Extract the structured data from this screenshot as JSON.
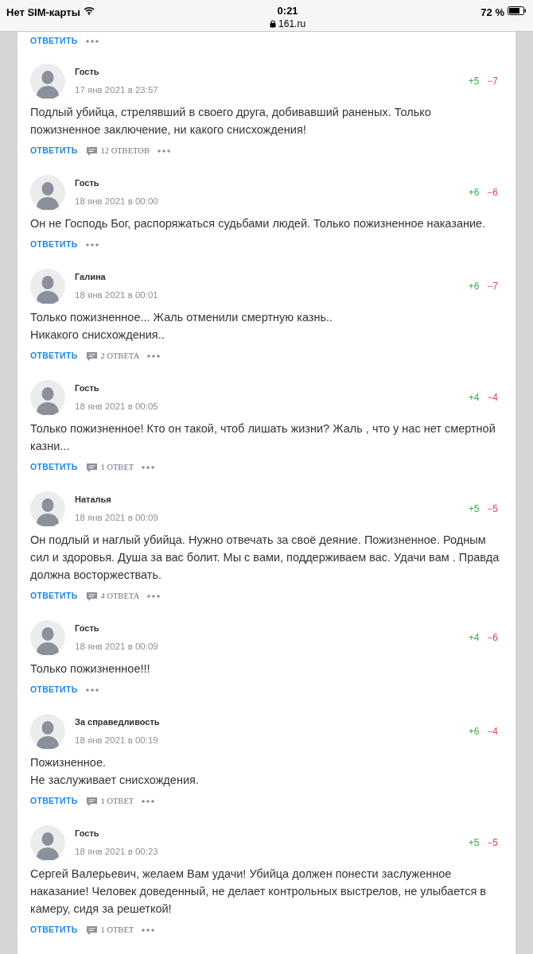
{
  "status_bar": {
    "carrier": "Нет SIM-карты",
    "time": "0:21",
    "url": "161.ru",
    "battery": "72 %"
  },
  "top_actions": {
    "reply": "ОТВЕТИТЬ"
  },
  "comments": [
    {
      "author": "Гость",
      "date": "17 янв 2021 в 23:57",
      "plus": "+5",
      "minus": "−7",
      "text": "Подлый убийца, стрелявший в своего друга, добивавший раненых. Только пожизненное заключение, ни какого снисхождения!",
      "reply": "ОТВЕТИТЬ",
      "replies": "12 ОТВЕТОВ"
    },
    {
      "author": "Гость",
      "date": "18 янв 2021 в 00:00",
      "plus": "+6",
      "minus": "−6",
      "text": "Он не Господь Бог, распоряжаться судьбами людей. Только пожизненное наказание.",
      "reply": "ОТВЕТИТЬ"
    },
    {
      "author": "Галина",
      "date": "18 янв 2021 в 00:01",
      "plus": "+6",
      "minus": "−7",
      "text": "Только пожизненное... Жаль отменили смертную казнь..\nНикакого снисхождения..",
      "reply": "ОТВЕТИТЬ",
      "replies": "2 ОТВЕТА"
    },
    {
      "author": "Гость",
      "date": "18 янв 2021 в 00:05",
      "plus": "+4",
      "minus": "−4",
      "text": "Только пожизненное! Кто он такой, чтоб лишать жизни? Жаль , что у нас нет смертной казни...",
      "reply": "ОТВЕТИТЬ",
      "replies": "1 ОТВЕТ"
    },
    {
      "author": "Наталья",
      "date": "18 янв 2021 в 00:09",
      "plus": "+5",
      "minus": "−5",
      "text": "Он подлый и наглый убийца. Нужно отвечать за своё деяние. Пожизненное. Родным сил и здоровья. Душа за вас болит. Мы с вами, поддерживаем вас. Удачи вам . Правда должна восторжествать.",
      "reply": "ОТВЕТИТЬ",
      "replies": "4 ОТВЕТА"
    },
    {
      "author": "Гость",
      "date": "18 янв 2021 в 00:09",
      "plus": "+4",
      "minus": "−6",
      "text": "Только пожизненное!!!",
      "reply": "ОТВЕТИТЬ"
    },
    {
      "author": "За справедливость",
      "date": "18 янв 2021 в 00:19",
      "plus": "+6",
      "minus": "−4",
      "text": "Пожизненное.\nНе заслуживает снисхождения.",
      "reply": "ОТВЕТИТЬ",
      "replies": "1 ОТВЕТ"
    },
    {
      "author": "Гость",
      "date": "18 янв 2021 в 00:23",
      "plus": "+5",
      "minus": "−5",
      "text": "Сергей Валерьевич, желаем Вам удачи! Убийца должен понести заслуженное наказание! Человек доведенный, не делает контрольных выстрелов, не улыбается в камеру, сидя за решеткой!",
      "reply": "ОТВЕТИТЬ",
      "replies": "1 ОТВЕТ"
    }
  ]
}
